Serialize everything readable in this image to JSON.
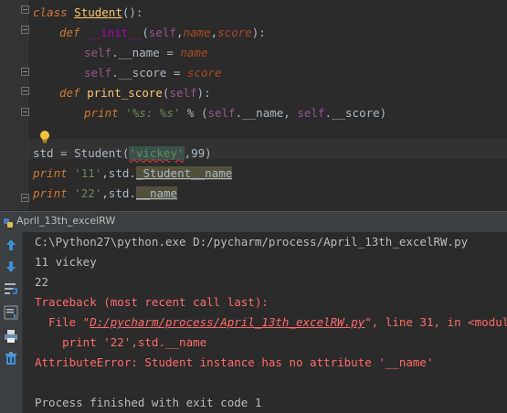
{
  "editor": {
    "line_class": {
      "kw": "class",
      "name": "Student",
      "rest": "():"
    },
    "line_init": {
      "kw": "def",
      "name": "__init__",
      "open": "(",
      "self": "self",
      "c1": ",",
      "p1": "name",
      "c2": ",",
      "p2": "score",
      "close": "):"
    },
    "line_assign1": {
      "self": "self",
      "attr": ".__name",
      "eq": " = ",
      "val": "name"
    },
    "line_assign2": {
      "self": "self",
      "attr": ".__score",
      "eq": " = ",
      "val": "score"
    },
    "line_def2": {
      "kw": "def",
      "name": "print_score",
      "open": "(",
      "self": "self",
      "close": "):"
    },
    "line_print": {
      "kw": "print",
      "str": " '%s: %s'",
      "pct": " % (",
      "self1": "self",
      "a1": ".__name, ",
      "self2": "self",
      "a2": ".__score)"
    },
    "line_std": {
      "lhs": "std = Student(",
      "str": "'vickey'",
      "rest": ",99)"
    },
    "line_p11": {
      "kw": "print",
      "str": " '11'",
      "rest": ",std.",
      "attr": "_Student__name"
    },
    "line_p22": {
      "kw": "print",
      "str": " '22'",
      "rest": ",std.",
      "attr": "__name"
    }
  },
  "run_panel": {
    "title": "April_13th_excelRW"
  },
  "console": {
    "cmd": "C:\\Python27\\python.exe D:/pycharm/process/April_13th_excelRW.py",
    "out1": "11 vickey",
    "out2": "22",
    "traceback": "Traceback (most recent call last):",
    "file_prefix": "  File \"",
    "file_link": "D:/pycharm/process/April_13th_excelRW.py",
    "file_suffix": "\", line 31, in <module>",
    "code": "    print '22',std.__name",
    "error": "AttributeError: Student instance has no attribute '__name'",
    "finished": "Process finished with exit code 1"
  },
  "colors": {
    "editor_bg": "#2b2b2b",
    "keyword": "#cc7832",
    "string": "#6a8759",
    "error_text": "#ff6b68",
    "panel_bg": "#3c3f41"
  },
  "icons": [
    "fold-marker-icon",
    "lightbulb-icon",
    "python-run-icon",
    "up-arrow-icon",
    "down-arrow-icon",
    "soft-wrap-icon",
    "scroll-to-end-icon",
    "print-icon",
    "trash-icon"
  ]
}
